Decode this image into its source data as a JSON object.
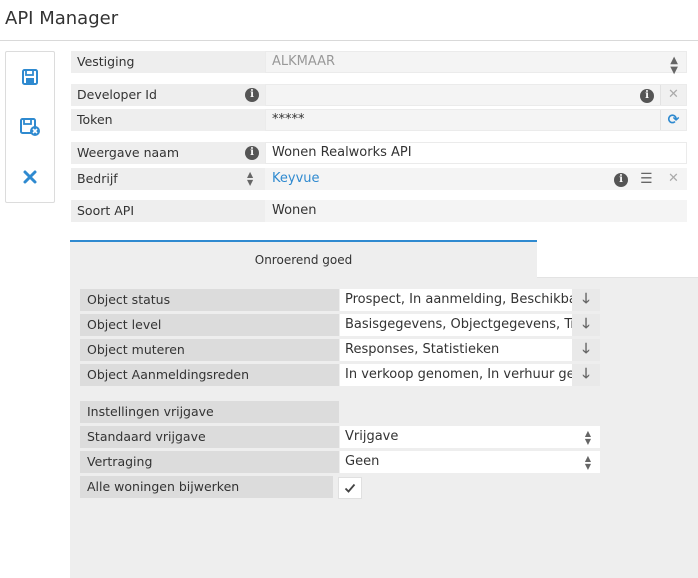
{
  "page": {
    "title": "API Manager"
  },
  "toolbar": {
    "save_icon": "save-icon",
    "save_close_icon": "save-close-icon",
    "close_icon": "close-icon"
  },
  "form": {
    "vestiging": {
      "label": "Vestiging",
      "value": "ALKMAAR"
    },
    "developer_id": {
      "label": "Developer Id",
      "value": ""
    },
    "token": {
      "label": "Token",
      "value": "*****"
    },
    "weergave_naam": {
      "label": "Weergave naam",
      "value": "Wonen Realworks API"
    },
    "bedrijf": {
      "label": "Bedrijf",
      "value": "Keyvue"
    },
    "soort_api": {
      "label": "Soort API",
      "value": "Wonen"
    }
  },
  "tabs": [
    {
      "label": "Onroerend goed",
      "active": true
    }
  ],
  "settings": {
    "object_status": {
      "label": "Object status",
      "value": "Prospect, In aanmelding, Beschikbaar"
    },
    "object_level": {
      "label": "Object level",
      "value": "Basisgegevens, Objectgegevens, Tran"
    },
    "object_muteren": {
      "label": "Object muteren",
      "value": "Responses, Statistieken"
    },
    "object_aanmeldingsreden": {
      "label": "Object Aanmeldingsreden",
      "value": "In verkoop genomen, In verhuur gen"
    },
    "instellingen_vrijgave": {
      "label": "Instellingen vrijgave"
    },
    "standaard_vrijgave": {
      "label": "Standaard vrijgave",
      "value": "Vrijgave"
    },
    "vertraging": {
      "label": "Vertraging",
      "value": "Geen"
    },
    "alle_woningen": {
      "label": "Alle woningen bijwerken",
      "checked": true
    }
  },
  "colors": {
    "accent": "#2f8ad0",
    "label_bg": "#eeeeee",
    "panel_bg": "#eeeeee"
  }
}
